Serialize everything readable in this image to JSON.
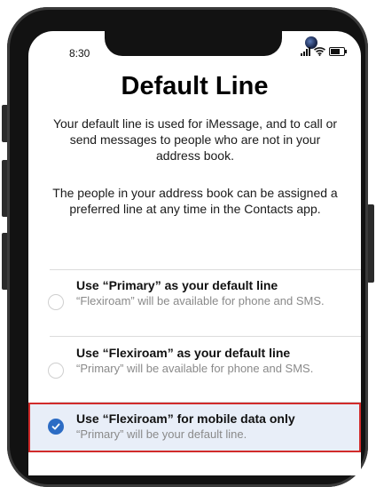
{
  "status_bar": {
    "time": "8:30",
    "signal_bars": 4,
    "battery_level": 0.85
  },
  "screen": {
    "title": "Default Line",
    "paragraph_1": "Your default line is used for iMessage, and to call or send messages to people who are not in your address book.",
    "paragraph_2": "The people in your address book can be assigned a preferred line at any time in the Contacts app."
  },
  "options": [
    {
      "title": "Use “Primary” as your default line",
      "subtitle": "“Flexiroam” will be available for phone and SMS.",
      "selected": false
    },
    {
      "title": "Use “Flexiroam” as your default line",
      "subtitle": "“Primary” will be available for phone and SMS.",
      "selected": false
    },
    {
      "title": "Use “Flexiroam” for mobile data only",
      "subtitle": "“Primary” will be your default line.",
      "selected": true
    }
  ],
  "colors": {
    "accent": "#2c6cc4",
    "selected_row_bg": "#e8eef8",
    "highlight_border": "#d12b2b",
    "subtitle_text": "#8a8a8a",
    "phone_frame": "#121212"
  },
  "icons": {
    "signal": "cellular-signal-icon",
    "wifi": "wifi-icon",
    "battery": "battery-icon",
    "checkmark": "checkmark-icon",
    "camera": "front-camera-icon"
  }
}
